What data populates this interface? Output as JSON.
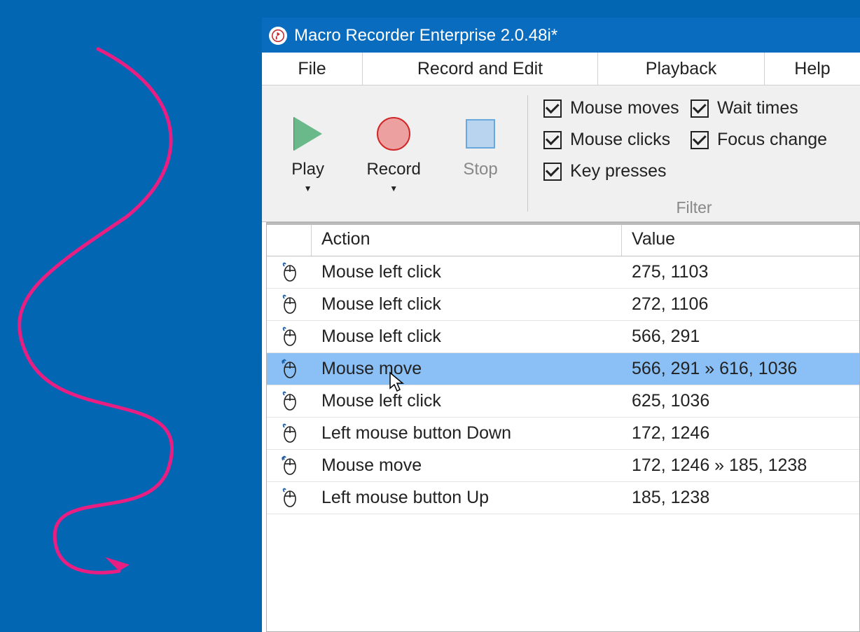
{
  "window_title": "Macro Recorder Enterprise 2.0.48i*",
  "menu": {
    "file": "File",
    "record_edit": "Record and Edit",
    "playback": "Playback",
    "help": "Help"
  },
  "toolbar": {
    "play": "Play",
    "record": "Record",
    "stop": "Stop",
    "filter_label": "Filter",
    "checks": {
      "mouse_moves": "Mouse moves",
      "mouse_clicks": "Mouse clicks",
      "key_presses": "Key presses",
      "wait_times": "Wait times",
      "focus_change": "Focus change"
    }
  },
  "table": {
    "headers": {
      "action": "Action",
      "value": "Value"
    },
    "rows": [
      {
        "action": "Mouse left click",
        "value": "275, 1103",
        "icon": "mouse",
        "selected": false
      },
      {
        "action": "Mouse left click",
        "value": "272, 1106",
        "icon": "mouse",
        "selected": false
      },
      {
        "action": "Mouse left click",
        "value": "566, 291",
        "icon": "mouse",
        "selected": false
      },
      {
        "action": "Mouse move",
        "value": "566, 291 » 616, 1036",
        "icon": "mouse-move",
        "selected": true
      },
      {
        "action": "Mouse left click",
        "value": "625, 1036",
        "icon": "mouse",
        "selected": false
      },
      {
        "action": "Left mouse button Down",
        "value": "172, 1246",
        "icon": "mouse",
        "selected": false
      },
      {
        "action": "Mouse move",
        "value": "172, 1246 » 185, 1238",
        "icon": "mouse-move",
        "selected": false
      },
      {
        "action": "Left mouse button Up",
        "value": "185, 1238",
        "icon": "mouse",
        "selected": false
      }
    ]
  }
}
